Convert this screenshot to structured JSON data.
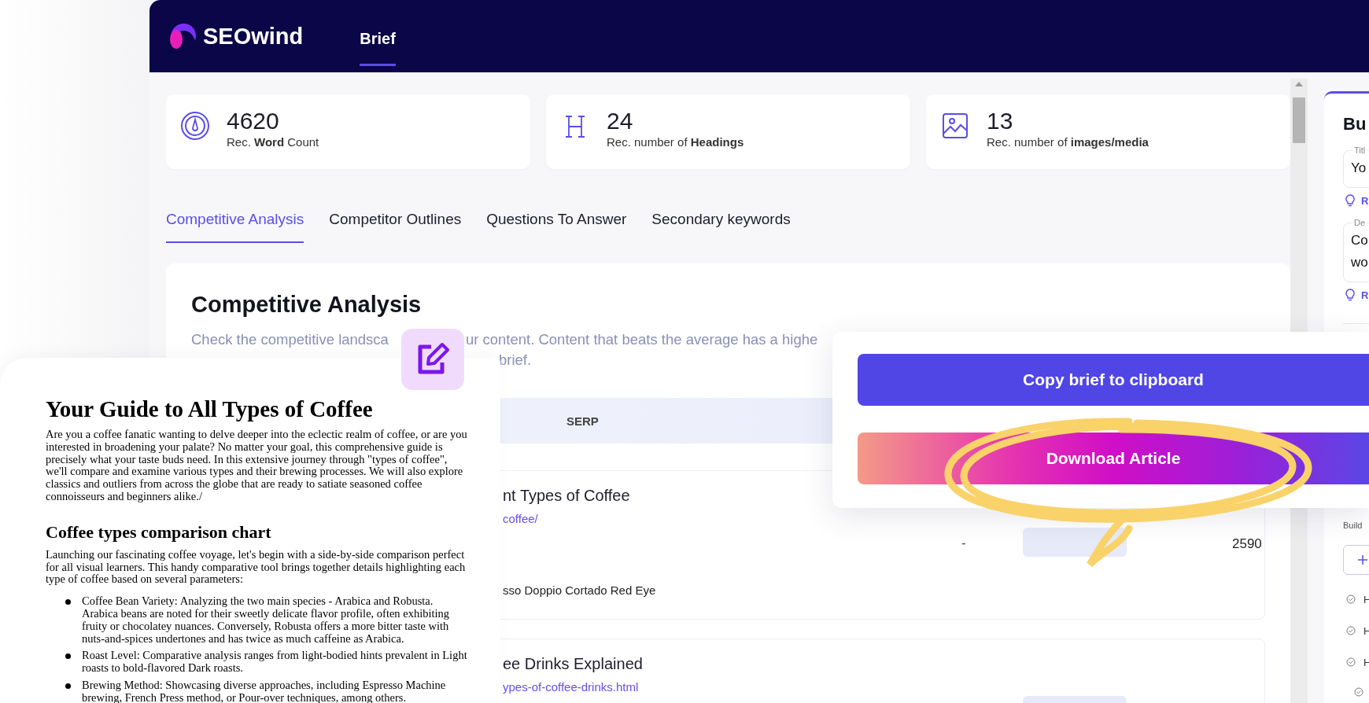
{
  "header": {
    "logo_text": "SEOwind",
    "tabs": [
      {
        "label": "Brief",
        "selected": true
      }
    ]
  },
  "stats": [
    {
      "kind": "gauge",
      "value": "4620",
      "label": "Rec. **Word** Count"
    },
    {
      "kind": "heading",
      "value": "24",
      "label": "Rec. number of **Headings**"
    },
    {
      "kind": "image",
      "value": "13",
      "label": "Rec. number of **images/media**"
    }
  ],
  "tabs": [
    {
      "label": "Competitive Analysis",
      "selected": true
    },
    {
      "label": "Competitor Outlines",
      "selected": false
    },
    {
      "label": "Questions To Answer",
      "selected": false
    },
    {
      "label": "Secondary keywords",
      "selected": false
    }
  ],
  "analysis": {
    "title": "Competitive Analysis",
    "description_start": "Check the competitive landsca",
    "description_middle": "ur content. Content that beats the average has a highe",
    "description_end": "brief.",
    "table_header": "SERP",
    "rows": [
      {
        "title": "nt Types of Coffee",
        "url": "coffee/",
        "column_3": "-",
        "column_4": "2590",
        "keywords": "sso Doppio Cortado Red Eye"
      },
      {
        "title": "ee Drinks Explained",
        "url": "ypes-of-coffee-drinks.html"
      }
    ]
  },
  "side_panel": {
    "title": "Bu",
    "fields": [
      {
        "label": "Titl",
        "lines": [
          "Yo"
        ],
        "hint": "R"
      },
      {
        "label": "De",
        "lines": [
          "Co",
          "wo"
        ],
        "hint": "R"
      }
    ],
    "build_label": "Build",
    "outline": [
      {
        "kind": "heading",
        "text": "H"
      },
      {
        "kind": "heading",
        "text": "H"
      },
      {
        "kind": "heading",
        "text": "H",
        "children": [
          {
            "kind": "heading"
          }
        ]
      }
    ]
  },
  "popup": {
    "buttons": [
      {
        "label": "Copy brief to clipboard",
        "kind": "primary"
      },
      {
        "label": "Download Article",
        "kind": "gradient"
      }
    ]
  },
  "document": {
    "title": "Your Guide to All Types of Coffee",
    "intro": "Are you a coffee fanatic wanting to delve deeper into the eclectic realm of coffee, or are you interested in broadening your palate? No matter your goal, this comprehensive guide is precisely what your taste buds need. In this extensive journey through \"types of coffee\", we'll compare and examine various types and their brewing processes. We will also explore classics and outliers from across the globe that are ready to satiate seasoned coffee connoisseurs and beginners alike./",
    "section_title": "Coffee types comparison chart",
    "section_intro": "Launching our fascinating coffee voyage, let's begin with a side-by-side comparison perfect for all visual learners. This handy comparative tool brings together details highlighting each type of coffee based on several parameters:",
    "bullets": [
      "Coffee Bean Variety: Analyzing the two main species - Arabica and Robusta. Arabica beans are noted for their sweetly delicate flavor profile, often exhibiting fruity or chocolatey nuances. Conversely, Robusta offers a more bitter taste with nuts-and-spices undertones and has twice as much caffeine as Arabica.",
      "Roast Level: Comparative analysis ranges from light-bodied hints prevalent in Light roasts to bold-flavored Dark roasts.",
      "Brewing Method: Showcasing diverse approaches, including Espresso Machine brewing, French Press method, or Pour-over techniques, among others."
    ]
  }
}
